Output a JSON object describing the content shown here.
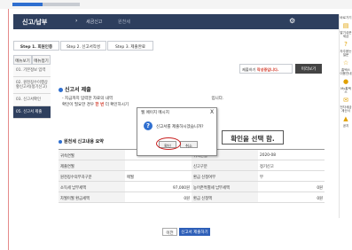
{
  "header": {
    "title": "신고/납부",
    "crumb1": "세금신고",
    "crumb2": "원천세"
  },
  "steps": [
    {
      "label": "Step 1. 회원인증"
    },
    {
      "label": "Step 2. 신고서작성"
    },
    {
      "label": "Step 3. 제출완료"
    }
  ],
  "side_menu": {
    "tabs": [
      "메뉴보기",
      "메뉴접기"
    ],
    "items": [
      {
        "label": "01. 기본정보 입력"
      },
      {
        "label": "02. 원천징수이행상황신고서(정기신고)"
      },
      {
        "label": "03. 신고서확인"
      },
      {
        "label": "05. 신고서 제출"
      }
    ]
  },
  "toolbar": {
    "notice_prefix": "제출하기 ",
    "notice_emphasis": "작성중입니다.",
    "print_label": "미리보기"
  },
  "sections": {
    "submit_title": "신고서 제출",
    "summary_title": "원천세 신고내용 요약"
  },
  "note": {
    "line1_a": "- 지금까지 입력한 자료의 내역",
    "line1_b": "입니다.",
    "line2_a": "확인이 필요한 경우 ",
    "line2_red": "한 번",
    "line2_b": " 더 확인하시기"
  },
  "table": {
    "rows": [
      [
        "귀속연월",
        "",
        "귀속연월",
        "2020-08"
      ],
      [
        "제출연월",
        "",
        "신고구분",
        "정기신고"
      ],
      [
        "원천징수의무자구분",
        "매월",
        "환급 신청여부",
        "부"
      ],
      [
        "소득세 납부세액",
        "97,000원",
        "농어촌특별세 납부세액",
        "0원"
      ],
      [
        "차월이월 환급세액",
        "0원",
        "환급 신청액",
        "0원"
      ]
    ]
  },
  "dialog": {
    "title": "웹 페이지 메시지",
    "close": "X",
    "message": "신고서를 제출하시겠습니까?",
    "ok_label": "확인",
    "cancel_label": "취소"
  },
  "callout": "확인을 선택 함.",
  "bottom": {
    "prev_label": "이전",
    "next_label": "신고서 제출하기"
  },
  "right_nav": {
    "top_label": "바로가기",
    "items": [
      {
        "label": "알기쉬운 세금",
        "icon": "book-icon"
      },
      {
        "label": "자주묻는 질문",
        "icon": "question-icon"
      },
      {
        "label": "홈택스 이용안내",
        "icon": "guide-icon"
      },
      {
        "label": "My홈택스",
        "icon": "user-icon"
      },
      {
        "label": "전자세금계산서",
        "icon": "mail-icon"
      },
      {
        "label": "공지",
        "icon": "notice-icon"
      }
    ]
  },
  "colors": {
    "nav_dark": "#2e3f5e",
    "accent_blue": "#2f6fd0",
    "emphasis_red": "#d23b2b"
  }
}
